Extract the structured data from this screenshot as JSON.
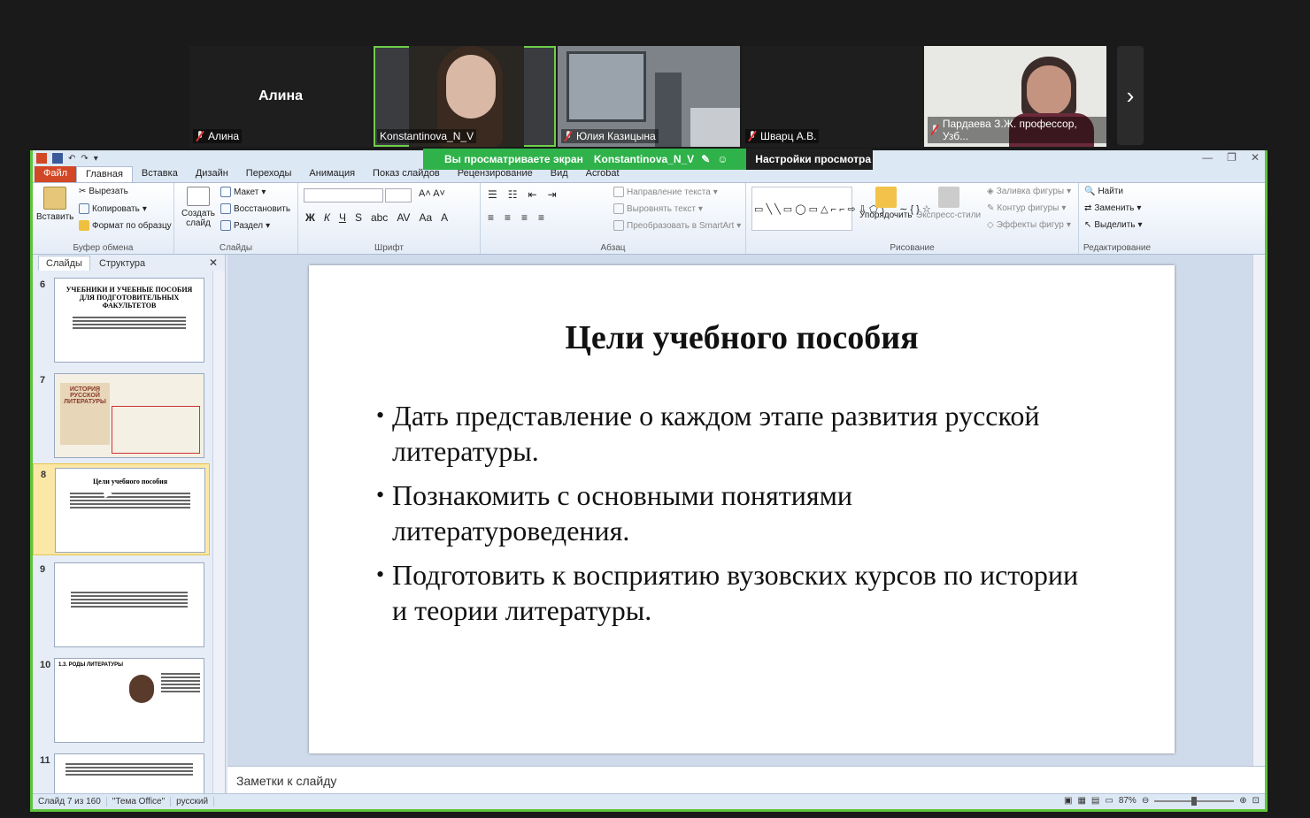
{
  "participants": [
    {
      "name": "Алина",
      "big_name": "Алина",
      "muted": true
    },
    {
      "name": "Konstantinova_N_V",
      "muted": false,
      "active": true
    },
    {
      "name": "Юлия Казицына",
      "muted": true
    },
    {
      "name": "Шварц А.В.",
      "muted": true
    },
    {
      "name": "Пардаева З.Ж. профессор, Узб...",
      "muted": true
    }
  ],
  "share_banner": {
    "text": "Вы просматриваете экран",
    "presenter": "Konstantinova_N_V",
    "settings": "Настройки просмотра"
  },
  "ribbon_tabs": [
    "Файл",
    "Главная",
    "Вставка",
    "Дизайн",
    "Переходы",
    "Анимация",
    "Показ слайдов",
    "Рецензирование",
    "Вид",
    "Acrobat"
  ],
  "active_tab": "Главная",
  "ribbon": {
    "paste": "Вставить",
    "cut": "Вырезать",
    "copy": "Копировать",
    "format_painter": "Формат по образцу",
    "clipboard_group": "Буфер обмена",
    "new_slide": "Создать слайд",
    "layout": "Макет",
    "reset": "Восстановить",
    "section": "Раздел",
    "slides_group": "Слайды",
    "font_group": "Шрифт",
    "text_direction": "Направление текста",
    "align_text": "Выровнять текст",
    "smartart": "Преобразовать в SmartArt",
    "paragraph_group": "Абзац",
    "arrange": "Упорядочить",
    "quick_styles": "Экспресс-стили",
    "shape_fill": "Заливка фигуры",
    "shape_outline": "Контур фигуры",
    "shape_effects": "Эффекты фигур",
    "drawing_group": "Рисование",
    "find": "Найти",
    "replace": "Заменить",
    "select": "Выделить",
    "editing_group": "Редактирование"
  },
  "pane": {
    "tab_slides": "Слайды",
    "tab_outline": "Структура",
    "close": "✕"
  },
  "thumbnails": [
    {
      "num": "6",
      "title": "УЧЕБНИКИ И УЧЕБНЫЕ ПОСОБИЯ ДЛЯ ПОДГОТОВИТЕЛЬНЫХ ФАКУЛЬТЕТОВ"
    },
    {
      "num": "7",
      "title": "ИСТОРИЯ РУССКОЙ ЛИТЕРАТУРЫ"
    },
    {
      "num": "8",
      "title": "Цели учебного пособия",
      "selected": true
    },
    {
      "num": "9",
      "title": ""
    },
    {
      "num": "10",
      "title": "1.3. РОДЫ ЛИТЕРАТУРЫ"
    },
    {
      "num": "11",
      "title": ""
    }
  ],
  "slide": {
    "title": "Цели учебного пособия",
    "bullets": [
      "Дать представление о каждом этапе развития русской литературы.",
      "Познакомить с основными понятиями литературоведения.",
      "Подготовить к восприятию вузовских курсов по истории и теории литературы."
    ]
  },
  "notes_placeholder": "Заметки к слайду",
  "status": {
    "slide": "Слайд 7 из 160",
    "theme": "\"Тема Office\"",
    "lang": "русский",
    "zoom": "87%"
  },
  "colors": {
    "share_green": "#2fb24a",
    "border_green": "#5ec43a",
    "file_tab": "#d24726"
  }
}
